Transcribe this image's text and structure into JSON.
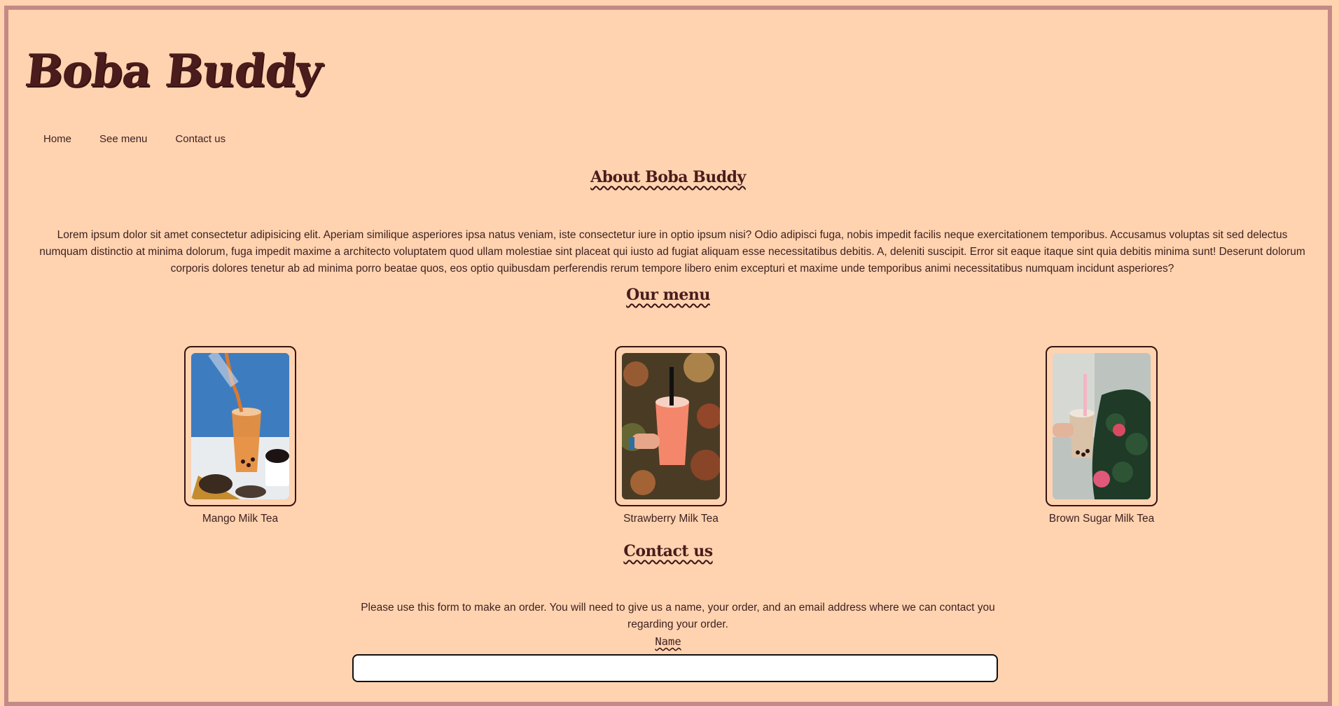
{
  "brand": {
    "logo": "Boba Buddy"
  },
  "nav": {
    "items": [
      "Home",
      "See menu",
      "Contact us"
    ]
  },
  "about": {
    "title": "About Boba Buddy",
    "text": "Lorem ipsum dolor sit amet consectetur adipisicing elit. Aperiam similique asperiores ipsa natus veniam, iste consectetur iure in optio ipsum nisi? Odio adipisci fuga, nobis impedit facilis neque exercitationem temporibus. Accusamus voluptas sit sed delectus numquam distinctio at minima dolorum, fuga impedit maxime a architecto voluptatem quod ullam molestiae sint placeat qui iusto ad fugiat aliquam esse necessitatibus debitis. A, deleniti suscipit. Error sit eaque itaque sint quia debitis minima sunt! Deserunt dolorum corporis dolores tenetur ab ad minima porro beatae quos, eos optio quibusdam perferendis rerum tempore libero enim excepturi et maxime unde temporibus animi necessitatibus numquam incidunt asperiores?"
  },
  "menu": {
    "title": "Our menu",
    "items": [
      {
        "label": "Mango Milk Tea"
      },
      {
        "label": "Strawberry Milk Tea"
      },
      {
        "label": "Brown Sugar Milk Tea"
      }
    ]
  },
  "contact": {
    "title": "Contact us",
    "text": "Please use this form to make an order. You will need to give us a name, your order, and an email address where we can contact you regarding your order.",
    "name_label": "Name",
    "name_value": ""
  },
  "colors": {
    "background": "#ffd3b0",
    "frame": "#c48a86",
    "text": "#3d1f1f",
    "accent": "#4a1c1c"
  }
}
